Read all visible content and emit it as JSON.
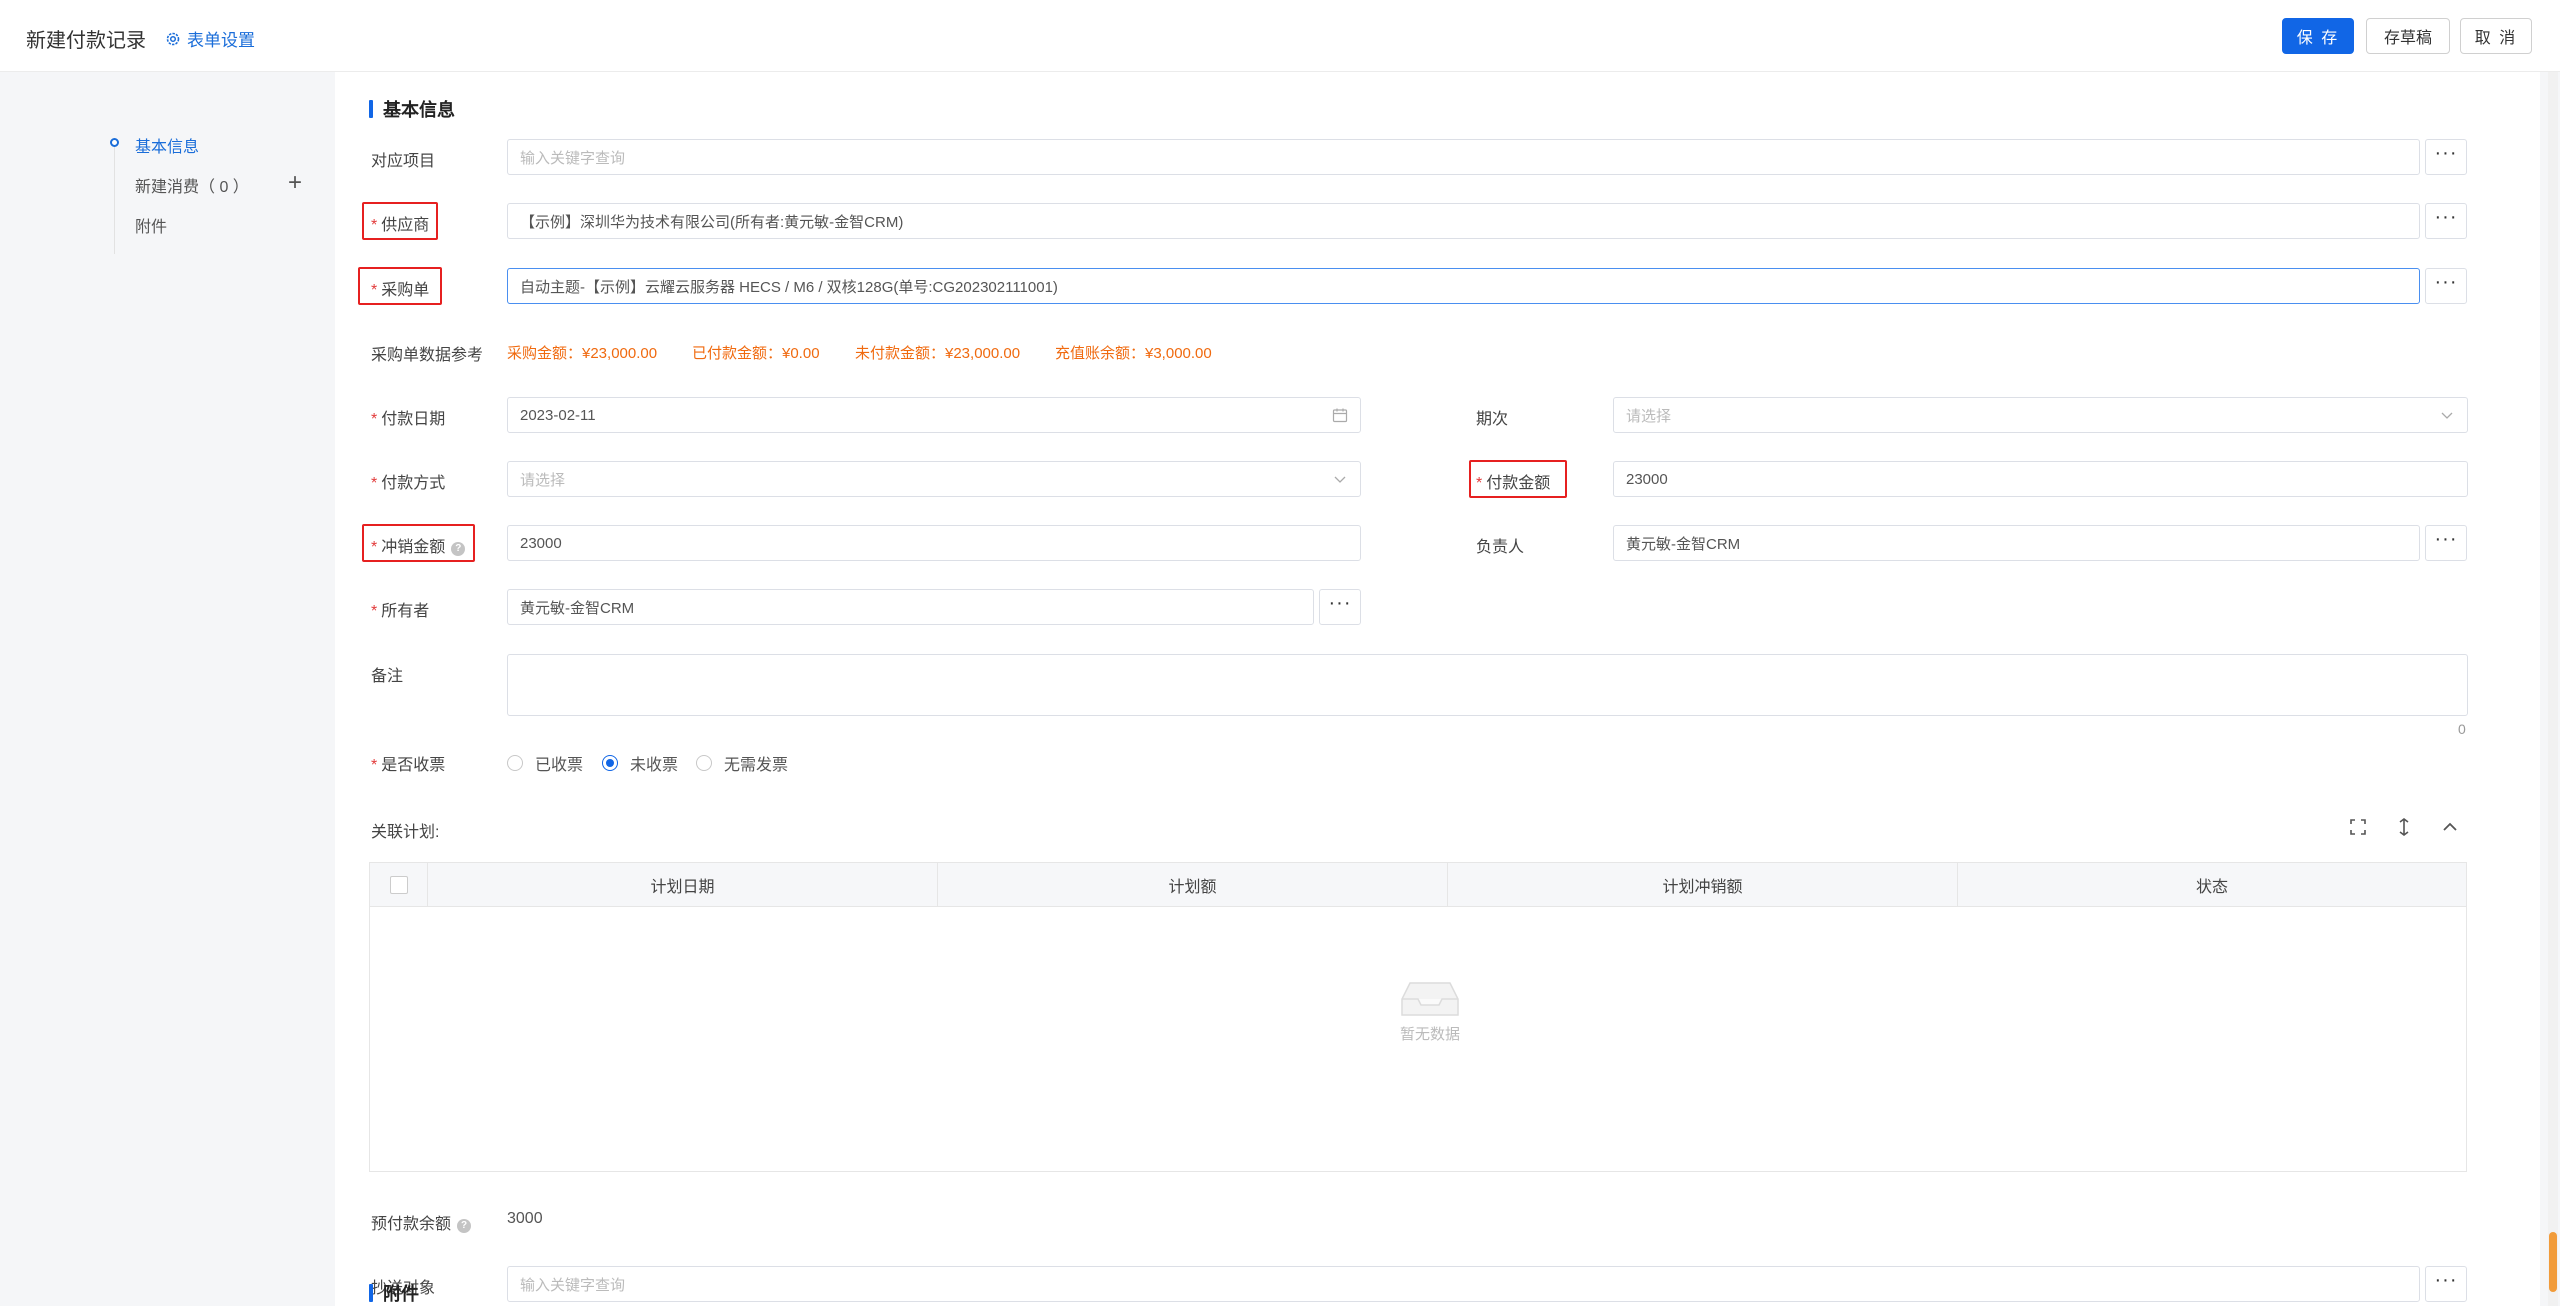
{
  "header": {
    "title": "新建付款记录",
    "form_settings": "表单设置",
    "save": "保 存",
    "draft": "存草稿",
    "cancel": "取 消"
  },
  "sidenav": {
    "items": [
      {
        "label": "基本信息",
        "active": true
      },
      {
        "label": "新建消费（ 0 ）"
      },
      {
        "label": "附件"
      }
    ],
    "plus": "+"
  },
  "sections": {
    "basic": "基本信息",
    "attachment": "附件"
  },
  "fields": {
    "project": {
      "label": "对应项目",
      "placeholder": "输入关键字查询"
    },
    "supplier": {
      "label": "供应商",
      "value": "【示例】深圳华为技术有限公司(所有者:黄元敏-金智CRM)"
    },
    "purchase_order": {
      "label": "采购单",
      "value": "自动主题-【示例】云耀云服务器 HECS / M6 / 双核128G(单号:CG202302111001)"
    },
    "po_reference": {
      "label": "采购单数据参考",
      "items": [
        "采购金额：¥23,000.00",
        "已付款金额：¥0.00",
        "未付款金额：¥23,000.00",
        "充值账余额：¥3,000.00"
      ]
    },
    "pay_date": {
      "label": "付款日期",
      "value": "2023-02-11"
    },
    "period": {
      "label": "期次",
      "placeholder": "请选择"
    },
    "pay_method": {
      "label": "付款方式",
      "placeholder": "请选择"
    },
    "pay_amount": {
      "label": "付款金额",
      "value": "23000"
    },
    "offset_amount": {
      "label": "冲销金额",
      "value": "23000"
    },
    "owner_person": {
      "label": "负责人",
      "value": "黄元敏-金智CRM"
    },
    "owner": {
      "label": "所有者",
      "value": "黄元敏-金智CRM"
    },
    "remark": {
      "label": "备注",
      "counter": "0"
    },
    "invoice": {
      "label": "是否收票",
      "options": [
        "已收票",
        "未收票",
        "无需发票"
      ],
      "selected": "未收票"
    },
    "plan": {
      "label": "关联计划:",
      "columns": [
        "计划日期",
        "计划额",
        "计划冲销额",
        "状态"
      ],
      "empty": "暂无数据"
    },
    "prepay_balance": {
      "label": "预付款余额",
      "value": "3000"
    },
    "cc": {
      "label": "抄送对象",
      "placeholder": "输入关键字查询"
    }
  },
  "required_mark": "*",
  "dots": "···",
  "help": "?",
  "colors": {
    "primary": "#1166e6",
    "link": "#1a6dd9",
    "reference_orange": "#f06a0f",
    "required_red": "#e23b3b",
    "highlight_box": "#e62020"
  }
}
